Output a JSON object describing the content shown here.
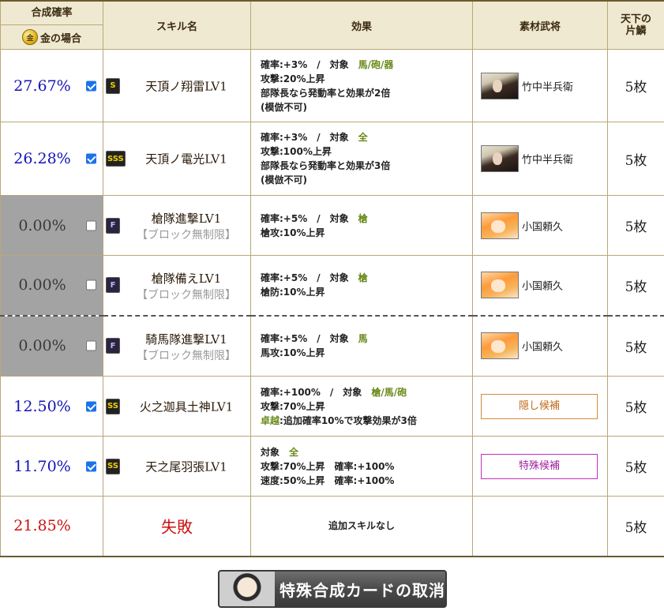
{
  "header": {
    "rate_title": "合成確率",
    "rate_subtitle": "金の場合",
    "coin_glyph": "金",
    "skill_col": "スキル名",
    "effect_col": "効果",
    "material_col": "素材武将",
    "tenka_col": "天下の片鱗"
  },
  "rows": [
    {
      "rate": "27.67%",
      "checked": true,
      "rank": "S",
      "skill": "天頂ノ翔雷LV1",
      "effects": [
        [
          {
            "t": "確率:+3%　/　対象　"
          },
          {
            "t": "馬/砲/器",
            "g": true
          }
        ],
        [
          {
            "t": "攻撃:20%上昇"
          }
        ],
        [
          {
            "t": "部隊長なら発動率と効果が2倍"
          }
        ],
        [
          {
            "t": "(模倣不可)"
          }
        ]
      ],
      "material": "竹中半兵衛",
      "portrait": "dark",
      "tenka": "5枚"
    },
    {
      "rate": "26.28%",
      "checked": true,
      "rank": "SSS",
      "skill": "天頂ノ電光LV1",
      "effects": [
        [
          {
            "t": "確率:+3%　/　対象　"
          },
          {
            "t": "全",
            "g": true
          }
        ],
        [
          {
            "t": "攻撃:100%上昇"
          }
        ],
        [
          {
            "t": "部隊長なら発動率と効果が3倍"
          }
        ],
        [
          {
            "t": "(模倣不可)"
          }
        ]
      ],
      "material": "竹中半兵衛",
      "portrait": "dark",
      "tenka": "5枚"
    },
    {
      "rate": "0.00%",
      "checked": false,
      "rank": "F",
      "skill": "槍隊進撃LV1",
      "block": "【ブロック無制限】",
      "effects": [
        [
          {
            "t": "確率:+5%　/　対象　"
          },
          {
            "t": "槍",
            "g": true
          }
        ],
        [
          {
            "t": "槍攻:10%上昇"
          }
        ]
      ],
      "material": "小国頼久",
      "portrait": "orange",
      "tenka": "5枚"
    },
    {
      "rate": "0.00%",
      "checked": false,
      "rank": "F",
      "skill": "槍隊備えLV1",
      "block": "【ブロック無制限】",
      "effects": [
        [
          {
            "t": "確率:+5%　/　対象　"
          },
          {
            "t": "槍",
            "g": true
          }
        ],
        [
          {
            "t": "槍防:10%上昇"
          }
        ]
      ],
      "material": "小国頼久",
      "portrait": "orange",
      "tenka": "5枚"
    },
    {
      "rate": "0.00%",
      "checked": false,
      "rank": "F",
      "skill": "騎馬隊進撃LV1",
      "block": "【ブロック無制限】",
      "effects": [
        [
          {
            "t": "確率:+5%　/　対象　"
          },
          {
            "t": "馬",
            "g": true
          }
        ],
        [
          {
            "t": "馬攻:10%上昇"
          }
        ]
      ],
      "material": "小国頼久",
      "portrait": "orange",
      "tenka": "5枚"
    },
    {
      "rate": "12.50%",
      "checked": true,
      "rank": "SS",
      "skill": "火之迦具土神LV1",
      "effects": [
        [
          {
            "t": "確率:+100%　/　対象　"
          },
          {
            "t": "槍/馬/砲",
            "g": true
          }
        ],
        [
          {
            "t": "攻撃:70%上昇"
          }
        ],
        [
          {
            "t": "卓越",
            "g": true
          },
          {
            "t": ":追加確率10%で攻撃効果が3倍"
          }
        ]
      ],
      "candidate": "隠し候補",
      "candidate_type": "hidden",
      "tenka": "5枚"
    },
    {
      "rate": "11.70%",
      "checked": true,
      "rank": "SS",
      "skill": "天之尾羽張LV1",
      "effects": [
        [
          {
            "t": "対象　"
          },
          {
            "t": "全",
            "g": true
          }
        ],
        [
          {
            "t": "攻撃:70%上昇　確率:+100%"
          }
        ],
        [
          {
            "t": "速度:50%上昇　確率:+100%"
          }
        ]
      ],
      "candidate": "特殊候補",
      "candidate_type": "special",
      "tenka": "5枚"
    }
  ],
  "fail_row": {
    "rate": "21.85%",
    "label": "失敗",
    "effect": "追加スキルなし",
    "tenka": "5枚"
  },
  "cancel_button": {
    "label": "特殊合成カードの取消"
  }
}
